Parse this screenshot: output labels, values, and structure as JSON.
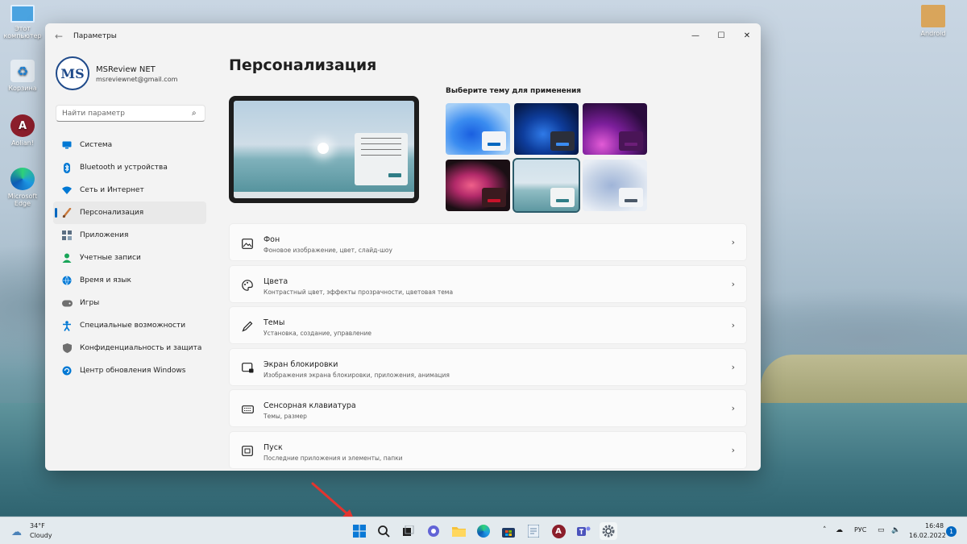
{
  "desktop": {
    "icons": [
      {
        "label": "Этот компьютер",
        "icon": "monitor-icon"
      },
      {
        "label": "Корзина",
        "icon": "recycle-bin-icon"
      },
      {
        "label": "Aolian!",
        "icon": "aolian-app-icon"
      },
      {
        "label": "Microsoft Edge",
        "icon": "edge-icon"
      },
      {
        "label": "Android",
        "icon": "package-box-icon"
      }
    ]
  },
  "window": {
    "title": "Параметры",
    "back_icon": "back-arrow-icon",
    "controls": {
      "minimize": "—",
      "maximize": "☐",
      "close": "✕"
    }
  },
  "profile": {
    "initials": "MS",
    "name": "MSReview NET",
    "email": "msreviewnet@gmail.com"
  },
  "search": {
    "placeholder": "Найти параметр"
  },
  "nav": {
    "items": [
      {
        "label": "Система",
        "icon": "system-icon",
        "color": "#0078d4"
      },
      {
        "label": "Bluetooth и устройства",
        "icon": "bluetooth-icon",
        "color": "#0078d4"
      },
      {
        "label": "Сеть и Интернет",
        "icon": "wifi-icon",
        "color": "#0078d4"
      },
      {
        "label": "Персонализация",
        "icon": "brush-icon",
        "color": "#c97a3d",
        "active": true
      },
      {
        "label": "Приложения",
        "icon": "apps-icon",
        "color": "#5b6e82"
      },
      {
        "label": "Учетные записи",
        "icon": "user-icon",
        "color": "#18a558"
      },
      {
        "label": "Время и язык",
        "icon": "globe-clock-icon",
        "color": "#0078d4"
      },
      {
        "label": "Игры",
        "icon": "gamepad-icon",
        "color": "#6f6f6f"
      },
      {
        "label": "Специальные возможности",
        "icon": "accessibility-icon",
        "color": "#0078d4"
      },
      {
        "label": "Конфиденциальность и защита",
        "icon": "shield-icon",
        "color": "#6f6f6f"
      },
      {
        "label": "Центр обновления Windows",
        "icon": "update-icon",
        "color": "#0078d4"
      }
    ]
  },
  "main": {
    "title": "Персонализация",
    "theme_picker_label": "Выберите тему для применения",
    "themes": [
      {
        "name": "windows-light",
        "selected": false
      },
      {
        "name": "windows-dark",
        "selected": false
      },
      {
        "name": "glow",
        "selected": false
      },
      {
        "name": "captured-motion",
        "selected": false
      },
      {
        "name": "sunrise",
        "selected": true
      },
      {
        "name": "flow",
        "selected": false
      }
    ],
    "cards": [
      {
        "title": "Фон",
        "subtitle": "Фоновое изображение, цвет, слайд-шоу",
        "icon": "image-icon"
      },
      {
        "title": "Цвета",
        "subtitle": "Контрастный цвет, эффекты прозрачности, цветовая тема",
        "icon": "palette-icon"
      },
      {
        "title": "Темы",
        "subtitle": "Установка, создание, управление",
        "icon": "pen-icon"
      },
      {
        "title": "Экран блокировки",
        "subtitle": "Изображения экрана блокировки, приложения, анимация",
        "icon": "lock-screen-icon"
      },
      {
        "title": "Сенсорная клавиатура",
        "subtitle": "Темы, размер",
        "icon": "keyboard-icon"
      },
      {
        "title": "Пуск",
        "subtitle": "Последние приложения и элементы, папки",
        "icon": "start-menu-icon"
      }
    ]
  },
  "taskbar": {
    "weather": {
      "temp": "34°F",
      "desc": "Cloudy",
      "icon": "cloud-icon"
    },
    "apps": [
      {
        "name": "start-button",
        "icon": "windows-logo-icon"
      },
      {
        "name": "search-button",
        "icon": "search-icon"
      },
      {
        "name": "task-view-button",
        "icon": "task-view-icon"
      },
      {
        "name": "chat-button",
        "icon": "chat-icon"
      },
      {
        "name": "file-explorer-button",
        "icon": "folder-icon"
      },
      {
        "name": "edge-button",
        "icon": "edge-icon"
      },
      {
        "name": "store-button",
        "icon": "store-icon"
      },
      {
        "name": "notepad-button",
        "icon": "notepad-icon"
      },
      {
        "name": "aolian-button",
        "icon": "aolian-app-icon"
      },
      {
        "name": "teams-button",
        "icon": "teams-icon"
      },
      {
        "name": "settings-button",
        "icon": "gear-icon"
      }
    ],
    "tray": {
      "language": "РУС"
    },
    "clock": {
      "time": "16:48",
      "date": "16.02.2022"
    },
    "notifications": "1"
  }
}
